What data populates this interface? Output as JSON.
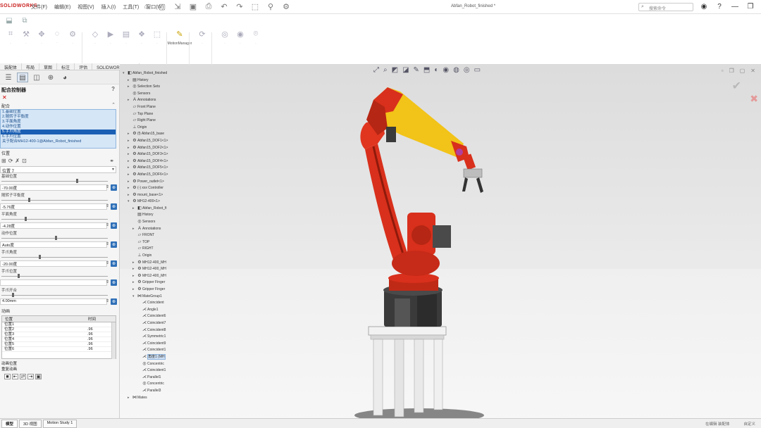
{
  "app": {
    "logo_text": "SOLIDWORKS",
    "document_title": "Abfan_Robot_finished *"
  },
  "menu": [
    "文件(F)",
    "编辑(E)",
    "视图(V)",
    "插入(I)",
    "工具(T)",
    "窗口(W)"
  ],
  "search": {
    "placeholder": "搜索命令"
  },
  "command_tabs": [
    "装配体",
    "布局",
    "草图",
    "标注",
    "评估",
    "SOLIDWORKS 插件"
  ],
  "active_tool_label": "MotionManager",
  "panel": {
    "title": "配合控制器",
    "section_mates": "配合",
    "mates": [
      "1.基础位置",
      "2.随转子平衡度",
      "3.平面角度",
      "4.动作位置",
      "5.手爪角度",
      "6.手爪位置",
      "关于配合MH12-400-1@Abfan_Robot_finished"
    ],
    "selected_mate_index": 4,
    "section_position": "位置",
    "position_value": "位置 7",
    "params": [
      {
        "label": "基础位置",
        "value": "-70.00度",
        "knob": 0.7
      },
      {
        "label": "随转子平衡度",
        "value": "-5.76度",
        "knob": 0.25
      },
      {
        "label": "平面角度",
        "value": "-4.28度",
        "knob": 0.22
      },
      {
        "label": "动作位置",
        "value": "Auto度",
        "knob": 0.5
      },
      {
        "label": "手爪角度",
        "value": "-20.00度",
        "knob": 0.35
      },
      {
        "label": "手爪位置",
        "value": "",
        "knob": 0.15
      },
      {
        "label": "手爪开合",
        "value": "4.00mm",
        "knob": 0.1
      }
    ],
    "section_anim": "动画",
    "timing_headers": [
      "位置",
      "时间"
    ],
    "timing_rows": [
      {
        "name": "位置1",
        "time": ""
      },
      {
        "name": "位置2",
        "time": ".96"
      },
      {
        "name": "位置3",
        "time": ".96"
      },
      {
        "name": "位置4",
        "time": ".96"
      },
      {
        "name": "位置5",
        "time": ".96"
      },
      {
        "name": "位置6",
        "time": ".96"
      }
    ],
    "option1": "动画位置",
    "option2": "重复动画"
  },
  "tree": [
    {
      "lvl": 0,
      "ex": "▾",
      "ic": "◧",
      "t": "Abfan_Robot_finished"
    },
    {
      "lvl": 1,
      "ex": "▸",
      "ic": "▤",
      "t": "History"
    },
    {
      "lvl": 1,
      "ex": "▸",
      "ic": "◎",
      "t": "Selection Sets"
    },
    {
      "lvl": 1,
      "ex": "",
      "ic": "◎",
      "t": "Sensors"
    },
    {
      "lvl": 1,
      "ex": "▸",
      "ic": "A",
      "t": "Annotations"
    },
    {
      "lvl": 1,
      "ex": "",
      "ic": "▱",
      "t": "Front Plane"
    },
    {
      "lvl": 1,
      "ex": "",
      "ic": "▱",
      "t": "Top Plane"
    },
    {
      "lvl": 1,
      "ex": "",
      "ic": "▱",
      "t": "Right Plane"
    },
    {
      "lvl": 1,
      "ex": "",
      "ic": "⊥",
      "t": "Origin"
    },
    {
      "lvl": 1,
      "ex": "▸",
      "ic": "⚙",
      "t": "(f) Abfan15_base"
    },
    {
      "lvl": 1,
      "ex": "▸",
      "ic": "⚙",
      "t": "Abfan15_DOF1<1>"
    },
    {
      "lvl": 1,
      "ex": "▸",
      "ic": "⚙",
      "t": "Abfan15_DOF2<1>"
    },
    {
      "lvl": 1,
      "ex": "▸",
      "ic": "⚙",
      "t": "Abfan15_DOF3<1>"
    },
    {
      "lvl": 1,
      "ex": "▸",
      "ic": "⚙",
      "t": "Abfan15_DOF4<1>"
    },
    {
      "lvl": 1,
      "ex": "▸",
      "ic": "⚙",
      "t": "Abfan15_DOF5<1>"
    },
    {
      "lvl": 1,
      "ex": "▸",
      "ic": "⚙",
      "t": "Abfan15_DOF6<1>"
    },
    {
      "lvl": 1,
      "ex": "▸",
      "ic": "⚙",
      "t": "Power_outlet<1>"
    },
    {
      "lvl": 1,
      "ex": "▸",
      "ic": "⚙",
      "t": "(-) xxx Controller"
    },
    {
      "lvl": 1,
      "ex": "▸",
      "ic": "⚙",
      "t": "mount_base<1>"
    },
    {
      "lvl": 1,
      "ex": "▾",
      "ic": "⚙",
      "t": "MH12-400<1>"
    },
    {
      "lvl": 2,
      "ex": "▸",
      "ic": "◧",
      "t": "Abfan_Robot_fi"
    },
    {
      "lvl": 2,
      "ex": "",
      "ic": "▤",
      "t": "History"
    },
    {
      "lvl": 2,
      "ex": "",
      "ic": "◎",
      "t": "Sensors"
    },
    {
      "lvl": 2,
      "ex": "▸",
      "ic": "A",
      "t": "Annotations"
    },
    {
      "lvl": 2,
      "ex": "",
      "ic": "▱",
      "t": "FRONT"
    },
    {
      "lvl": 2,
      "ex": "",
      "ic": "▱",
      "t": "TOP"
    },
    {
      "lvl": 2,
      "ex": "",
      "ic": "▱",
      "t": "RIGHT"
    },
    {
      "lvl": 2,
      "ex": "",
      "ic": "⊥",
      "t": "Origin"
    },
    {
      "lvl": 2,
      "ex": "▸",
      "ic": "⚙",
      "t": "MH12-400_MH"
    },
    {
      "lvl": 2,
      "ex": "▸",
      "ic": "⚙",
      "t": "MH12-400_MH"
    },
    {
      "lvl": 2,
      "ex": "▸",
      "ic": "⚙",
      "t": "MH12-400_MH"
    },
    {
      "lvl": 2,
      "ex": "▸",
      "ic": "⚙",
      "t": "Gripper Finger"
    },
    {
      "lvl": 2,
      "ex": "▸",
      "ic": "⚙",
      "t": "Gripper Finger"
    },
    {
      "lvl": 2,
      "ex": "▾",
      "ic": "⋈",
      "t": "MateGroup1"
    },
    {
      "lvl": 3,
      "ex": "",
      "ic": "⋌",
      "t": "Coincident"
    },
    {
      "lvl": 3,
      "ex": "",
      "ic": "⋌",
      "t": "Angle1"
    },
    {
      "lvl": 3,
      "ex": "",
      "ic": "⋌",
      "t": "Coincident6"
    },
    {
      "lvl": 3,
      "ex": "",
      "ic": "⋌",
      "t": "Coincident7"
    },
    {
      "lvl": 3,
      "ex": "",
      "ic": "⋌",
      "t": "Coincident8"
    },
    {
      "lvl": 3,
      "ex": "",
      "ic": "⋌",
      "t": "Symmetric1"
    },
    {
      "lvl": 3,
      "ex": "",
      "ic": "⋌",
      "t": "Coincident9"
    },
    {
      "lvl": 3,
      "ex": "",
      "ic": "⋌",
      "t": "Coincident1"
    },
    {
      "lvl": 3,
      "ex": "",
      "ic": "⋌",
      "t": "角度1 (MH"
    },
    {
      "lvl": 3,
      "ex": "",
      "ic": "◎",
      "t": "Concentric"
    },
    {
      "lvl": 3,
      "ex": "",
      "ic": "⋌",
      "t": "Coincident1"
    },
    {
      "lvl": 3,
      "ex": "",
      "ic": "⋌",
      "t": "Parallel1"
    },
    {
      "lvl": 3,
      "ex": "",
      "ic": "◎",
      "t": "Concentric"
    },
    {
      "lvl": 3,
      "ex": "",
      "ic": "⋌",
      "t": "Parallel3"
    },
    {
      "lvl": 1,
      "ex": "▸",
      "ic": "⋈",
      "t": "Mates"
    }
  ],
  "tree_selected_index": 42,
  "bottom_tabs": [
    "模型",
    "3D 视图",
    "Motion Study 1"
  ],
  "status_right": [
    "在编辑 装配体",
    "自定义"
  ],
  "colors": {
    "accent": "#1a5fb4",
    "robot_red": "#d8301c",
    "robot_yellow": "#f2c318",
    "cancel": "#e05a5a"
  }
}
